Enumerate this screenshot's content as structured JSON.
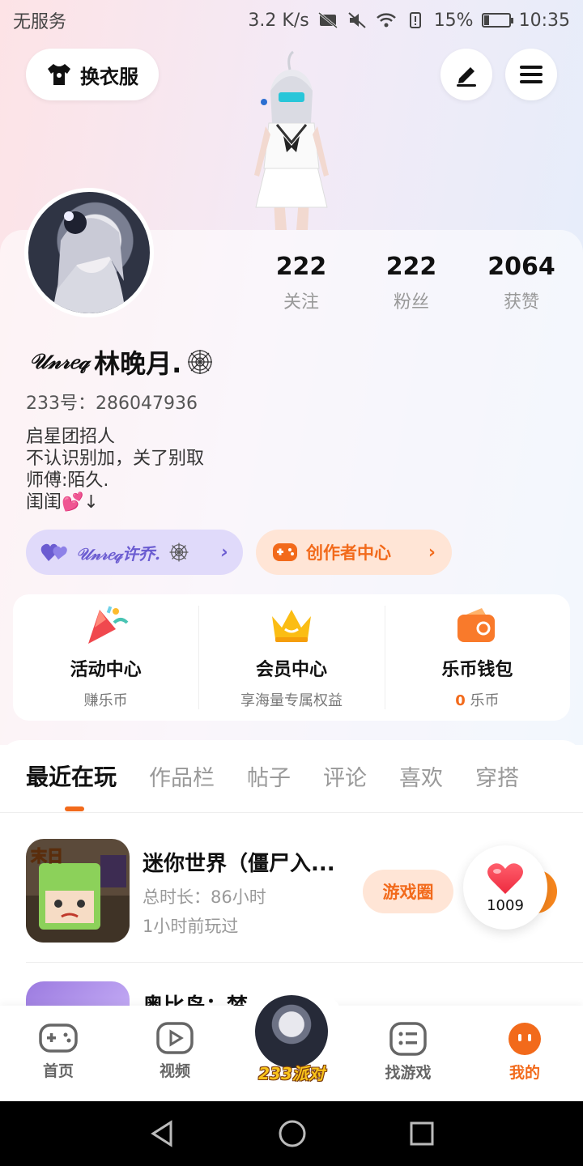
{
  "status_bar": {
    "carrier": "无服务",
    "speed": "3.2 K/s",
    "battery": "15%",
    "time": "10:35"
  },
  "header": {
    "dress_label": "换衣服"
  },
  "profile": {
    "stats": [
      {
        "value": "222",
        "label": "关注"
      },
      {
        "value": "222",
        "label": "粉丝"
      },
      {
        "value": "2064",
        "label": "获赞"
      }
    ],
    "nickname_prefix": "𝒰𝓃𝓇𝑒𝓆",
    "nickname": "林晚月.",
    "uid": "233号：286047936",
    "bio": [
      "启星团招人",
      "不认识别加，关了别取",
      "师傅:陌久.",
      "闺闺💕↓"
    ],
    "guild_label": "𝒰𝓃𝓇𝑒𝓆许乔.",
    "creator_label": "创作者中心"
  },
  "services": [
    {
      "title": "活动中心",
      "sub": "赚乐币"
    },
    {
      "title": "会员中心",
      "sub": "享海量专属权益"
    },
    {
      "title": "乐币钱包",
      "coin": "0",
      "sub": "乐币"
    }
  ],
  "tabs": [
    "最近在玩",
    "作品栏",
    "帖子",
    "评论",
    "喜欢",
    "穿搭"
  ],
  "games": [
    {
      "title": "迷你世界（僵尸入...",
      "duration": "总时长：86小时",
      "last_played": "1小时前玩过",
      "circle_label": "游戏圈",
      "icon_text": "末日"
    },
    {
      "title": "奥比岛：梦"
    }
  ],
  "like_count": "1009",
  "bottom_nav": [
    {
      "label": "首页"
    },
    {
      "label": "视频"
    },
    {
      "label": "233派对"
    },
    {
      "label": "找游戏"
    },
    {
      "label": "我的"
    }
  ],
  "colors": {
    "accent": "#f26a1b",
    "guild": "#6b5cd1"
  }
}
